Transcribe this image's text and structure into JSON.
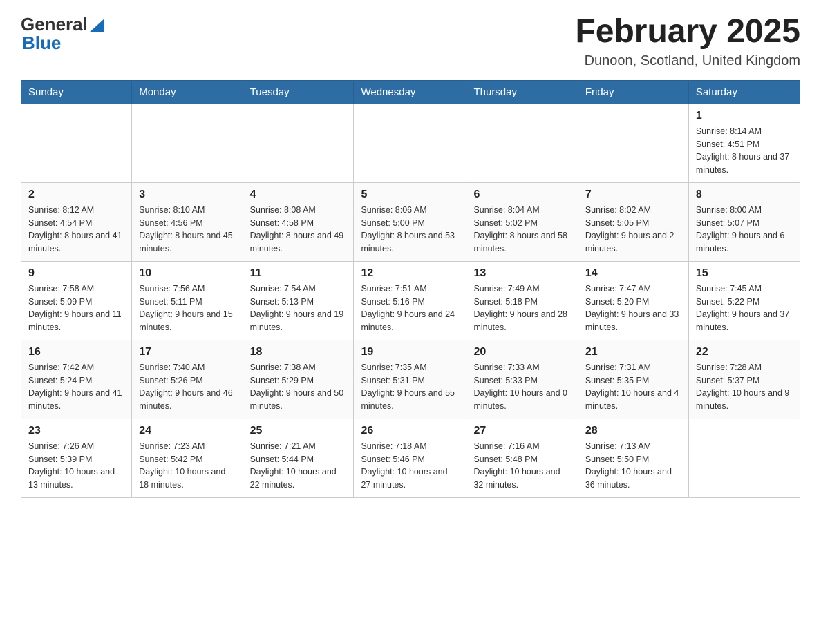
{
  "header": {
    "logo_line1": "General",
    "logo_line2": "Blue",
    "month_title": "February 2025",
    "location": "Dunoon, Scotland, United Kingdom"
  },
  "days_of_week": [
    "Sunday",
    "Monday",
    "Tuesday",
    "Wednesday",
    "Thursday",
    "Friday",
    "Saturday"
  ],
  "weeks": [
    [
      {
        "day": "",
        "info": ""
      },
      {
        "day": "",
        "info": ""
      },
      {
        "day": "",
        "info": ""
      },
      {
        "day": "",
        "info": ""
      },
      {
        "day": "",
        "info": ""
      },
      {
        "day": "",
        "info": ""
      },
      {
        "day": "1",
        "info": "Sunrise: 8:14 AM\nSunset: 4:51 PM\nDaylight: 8 hours and 37 minutes."
      }
    ],
    [
      {
        "day": "2",
        "info": "Sunrise: 8:12 AM\nSunset: 4:54 PM\nDaylight: 8 hours and 41 minutes."
      },
      {
        "day": "3",
        "info": "Sunrise: 8:10 AM\nSunset: 4:56 PM\nDaylight: 8 hours and 45 minutes."
      },
      {
        "day": "4",
        "info": "Sunrise: 8:08 AM\nSunset: 4:58 PM\nDaylight: 8 hours and 49 minutes."
      },
      {
        "day": "5",
        "info": "Sunrise: 8:06 AM\nSunset: 5:00 PM\nDaylight: 8 hours and 53 minutes."
      },
      {
        "day": "6",
        "info": "Sunrise: 8:04 AM\nSunset: 5:02 PM\nDaylight: 8 hours and 58 minutes."
      },
      {
        "day": "7",
        "info": "Sunrise: 8:02 AM\nSunset: 5:05 PM\nDaylight: 9 hours and 2 minutes."
      },
      {
        "day": "8",
        "info": "Sunrise: 8:00 AM\nSunset: 5:07 PM\nDaylight: 9 hours and 6 minutes."
      }
    ],
    [
      {
        "day": "9",
        "info": "Sunrise: 7:58 AM\nSunset: 5:09 PM\nDaylight: 9 hours and 11 minutes."
      },
      {
        "day": "10",
        "info": "Sunrise: 7:56 AM\nSunset: 5:11 PM\nDaylight: 9 hours and 15 minutes."
      },
      {
        "day": "11",
        "info": "Sunrise: 7:54 AM\nSunset: 5:13 PM\nDaylight: 9 hours and 19 minutes."
      },
      {
        "day": "12",
        "info": "Sunrise: 7:51 AM\nSunset: 5:16 PM\nDaylight: 9 hours and 24 minutes."
      },
      {
        "day": "13",
        "info": "Sunrise: 7:49 AM\nSunset: 5:18 PM\nDaylight: 9 hours and 28 minutes."
      },
      {
        "day": "14",
        "info": "Sunrise: 7:47 AM\nSunset: 5:20 PM\nDaylight: 9 hours and 33 minutes."
      },
      {
        "day": "15",
        "info": "Sunrise: 7:45 AM\nSunset: 5:22 PM\nDaylight: 9 hours and 37 minutes."
      }
    ],
    [
      {
        "day": "16",
        "info": "Sunrise: 7:42 AM\nSunset: 5:24 PM\nDaylight: 9 hours and 41 minutes."
      },
      {
        "day": "17",
        "info": "Sunrise: 7:40 AM\nSunset: 5:26 PM\nDaylight: 9 hours and 46 minutes."
      },
      {
        "day": "18",
        "info": "Sunrise: 7:38 AM\nSunset: 5:29 PM\nDaylight: 9 hours and 50 minutes."
      },
      {
        "day": "19",
        "info": "Sunrise: 7:35 AM\nSunset: 5:31 PM\nDaylight: 9 hours and 55 minutes."
      },
      {
        "day": "20",
        "info": "Sunrise: 7:33 AM\nSunset: 5:33 PM\nDaylight: 10 hours and 0 minutes."
      },
      {
        "day": "21",
        "info": "Sunrise: 7:31 AM\nSunset: 5:35 PM\nDaylight: 10 hours and 4 minutes."
      },
      {
        "day": "22",
        "info": "Sunrise: 7:28 AM\nSunset: 5:37 PM\nDaylight: 10 hours and 9 minutes."
      }
    ],
    [
      {
        "day": "23",
        "info": "Sunrise: 7:26 AM\nSunset: 5:39 PM\nDaylight: 10 hours and 13 minutes."
      },
      {
        "day": "24",
        "info": "Sunrise: 7:23 AM\nSunset: 5:42 PM\nDaylight: 10 hours and 18 minutes."
      },
      {
        "day": "25",
        "info": "Sunrise: 7:21 AM\nSunset: 5:44 PM\nDaylight: 10 hours and 22 minutes."
      },
      {
        "day": "26",
        "info": "Sunrise: 7:18 AM\nSunset: 5:46 PM\nDaylight: 10 hours and 27 minutes."
      },
      {
        "day": "27",
        "info": "Sunrise: 7:16 AM\nSunset: 5:48 PM\nDaylight: 10 hours and 32 minutes."
      },
      {
        "day": "28",
        "info": "Sunrise: 7:13 AM\nSunset: 5:50 PM\nDaylight: 10 hours and 36 minutes."
      },
      {
        "day": "",
        "info": ""
      }
    ]
  ]
}
